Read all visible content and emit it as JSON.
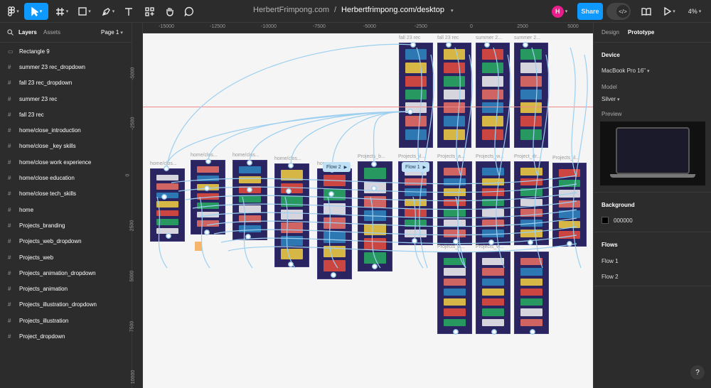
{
  "toolbar": {
    "share": "Share",
    "zoom": "4%",
    "avatar": "H"
  },
  "title": {
    "project": "HerbertFrimpong.com",
    "separator": "/",
    "file": "Herbertfrimpong.com/desktop"
  },
  "left": {
    "tab_layers": "Layers",
    "tab_assets": "Assets",
    "page": "Page 1",
    "layers": [
      "Rectangle 9",
      "summer 23 rec_dropdown",
      "fall 23 rec_dropdown",
      "summer 23 rec",
      "fall 23 rec",
      "home/close_introduction",
      "home/close _key skills",
      "home/close work experience",
      "home/close education",
      "home/close tech_skills",
      "home",
      "Projects_branding",
      "Projects_web_dropdown",
      "Projects_web",
      "Projects_animation_dropdown",
      "Projects_animation",
      "Projects_illustration_dropdown",
      "Projects_illustration",
      "Project_dropdown"
    ]
  },
  "rulers": {
    "h": [
      "-15000",
      "-12500",
      "-10000",
      "-7500",
      "-5000",
      "-2500",
      "0",
      "2500",
      "5000"
    ],
    "v": [
      "-5000",
      "-2500",
      "0",
      "2500",
      "5000",
      "7500",
      "10000"
    ]
  },
  "canvas": {
    "frame_labels": [
      "fall 23 rec",
      "fall 23 rec",
      "summer 2...",
      "summer 2...",
      "home/clos...",
      "home/clos...",
      "home/clos...",
      "home/clos...",
      "home",
      "Projects_b...",
      "Projects_il...",
      "Projects_a...",
      "Projects_w...",
      "Project_dr...",
      "Projects_il...",
      "Projects_a...",
      "Projects_w..."
    ],
    "flow_badges": [
      "Flow 2",
      "Flow 1"
    ]
  },
  "right": {
    "tab_design": "Design",
    "tab_prototype": "Prototype",
    "device_heading": "Device",
    "device": "MacBook Pro 16\"",
    "model_heading": "Model",
    "model": "Silver",
    "preview_heading": "Preview",
    "background_heading": "Background",
    "background_value": "000000",
    "background_color": "#000000",
    "flows_heading": "Flows",
    "flows": [
      "Flow 1",
      "Flow 2"
    ]
  },
  "colors": {
    "accent": "#0d99ff",
    "avatar": "#e91e8c",
    "frame": "#2a2560",
    "connector": "#9ccff0"
  }
}
